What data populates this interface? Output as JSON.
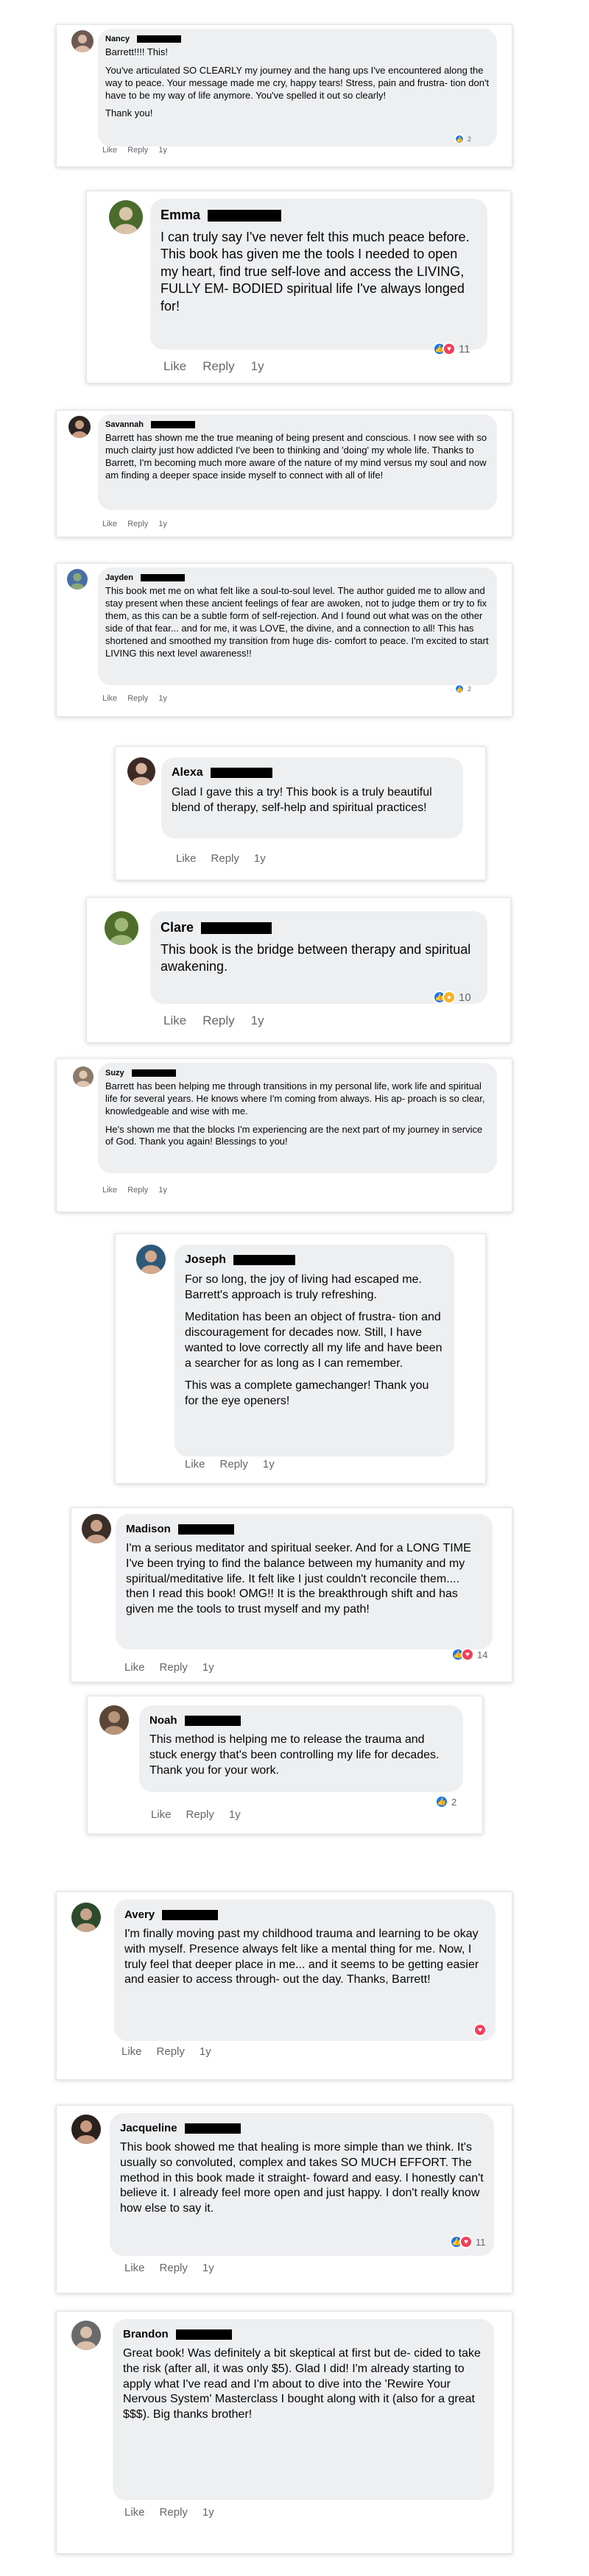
{
  "actions": {
    "like_label": "Like",
    "reply_label": "Reply",
    "time_label": "1y"
  },
  "colors": {
    "like_blue": "#1877f2",
    "love_red": "#f33e58",
    "wow_yellow": "#f7b125",
    "bubble": "#eeeff1",
    "meta_grey": "#65676b"
  },
  "comments": [
    {
      "name": "Nancy",
      "paragraphs": [
        "Barrett!!!! This!",
        "You've articulated SO CLEARLY my journey and the hang ups I've encountered along the way to peace. Your message made me cry, happy tears! Stress, pain and frustra- tion don't have to be my way of life anymore. You've spelled it out so clearly!",
        "Thank you!"
      ],
      "reactions": [
        "like-icon"
      ],
      "reaction_count": "2"
    },
    {
      "name": "Emma",
      "paragraphs": [
        "I can truly say I've never felt this much peace before. This book has given me the tools I needed to open my heart, find true self-love and access the LIVING, FULLY EM- BODIED spiritual life I've always longed for!"
      ],
      "reactions": [
        "like-icon",
        "love-icon"
      ],
      "reaction_count": "11"
    },
    {
      "name": "Savannah",
      "paragraphs": [
        "Barrett has shown me the true meaning of being present and conscious. I now see with so much clairty just how addicted I've been to thinking and 'doing' my whole life. Thanks to Barrett, I'm becoming much more aware of the nature of my mind versus my soul and now am finding a deeper space inside myself to connect with all of life!"
      ],
      "reactions": [],
      "reaction_count": ""
    },
    {
      "name": "Jayden",
      "paragraphs": [
        "This book met me on what felt like a soul-to-soul level. The author guided me to allow and stay present when these ancient feelings of fear are awoken, not to judge them or try to fix them, as this can be a subtle form of self-rejection. And I found out what was on the other side of that fear... and for me, it was LOVE, the divine, and a connection to all! This has shortened and smoothed my transition from huge dis- comfort to peace. I'm excited to start LIVING this next level awareness!!"
      ],
      "reactions": [
        "like-icon"
      ],
      "reaction_count": "2"
    },
    {
      "name": "Alexa",
      "paragraphs": [
        "Glad I gave this a try! This book is a truly beautiful blend of therapy, self-help and spiritual practices!"
      ],
      "reactions": [],
      "reaction_count": ""
    },
    {
      "name": "Clare",
      "paragraphs": [
        "This book is the bridge between therapy and spiritual awakening."
      ],
      "reactions": [
        "like-icon",
        "wow-icon"
      ],
      "reaction_count": "10"
    },
    {
      "name": "Suzy",
      "paragraphs": [
        "Barrett has been helping me through transitions in my personal life, work life and spiritual life for several years. He knows where I'm coming from always. His ap- proach is so clear, knowledgeable and wise with me.",
        "He's shown me that the blocks I'm experiencing are the next part of my journey in service of God. Thank you again! Blessings to you!"
      ],
      "reactions": [],
      "reaction_count": ""
    },
    {
      "name": "Joseph",
      "paragraphs": [
        "For so long, the joy of living had escaped me. Barrett's approach is truly refreshing.",
        "Meditation has been an object of frustra- tion and discouragement for decades now. Still, I have wanted to love correctly all my life and have been a searcher for as long as I can remember.",
        "This was a complete gamechanger! Thank you for the eye openers!"
      ],
      "reactions": [],
      "reaction_count": ""
    },
    {
      "name": "Madison",
      "paragraphs": [
        "I'm a serious meditator and spiritual seeker. And for a LONG TIME I've been trying to find the balance between my humanity and my spiritual/meditative life. It felt like I just couldn't reconcile them.... then I read this book! OMG!! It is the breakthrough shift and has given me the tools to trust myself and my path!"
      ],
      "reactions": [
        "like-icon",
        "love-icon"
      ],
      "reaction_count": "14"
    },
    {
      "name": "Noah",
      "paragraphs": [
        "This method is helping me to release the trauma and stuck energy that's been controlling my life for decades. Thank you for your work."
      ],
      "reactions": [
        "like-icon"
      ],
      "reaction_count": "2"
    },
    {
      "name": "Avery",
      "paragraphs": [
        "I'm finally moving past my childhood trauma and learning to be okay with myself. Presence always felt like a mental thing for me. Now, I truly feel that deeper place in me... and it seems to be getting easier and easier to access through- out the day. Thanks, Barrett!"
      ],
      "reactions": [
        "love-icon"
      ],
      "reaction_count": ""
    },
    {
      "name": "Jacqueline",
      "paragraphs": [
        "This book showed me that healing is more simple than we think. It's usually so convoluted, complex and takes SO MUCH EFFORT. The method in this book made it straight- foward and easy. I honestly can't believe it. I already feel more open and just happy. I don't really know how else to say it."
      ],
      "reactions": [
        "like-icon",
        "love-icon"
      ],
      "reaction_count": "11"
    },
    {
      "name": "Brandon",
      "paragraphs": [
        "Great book! Was definitely a bit skeptical at first but de- cided to take the risk (after all, it was only $5). Glad I did! I'm already starting to apply what I've read and I'm about to dive into the 'Rewire Your Nervous System' Masterclass I bought along with it (also for a great $$$). Big thanks brother!"
      ],
      "reactions": [],
      "reaction_count": ""
    }
  ]
}
